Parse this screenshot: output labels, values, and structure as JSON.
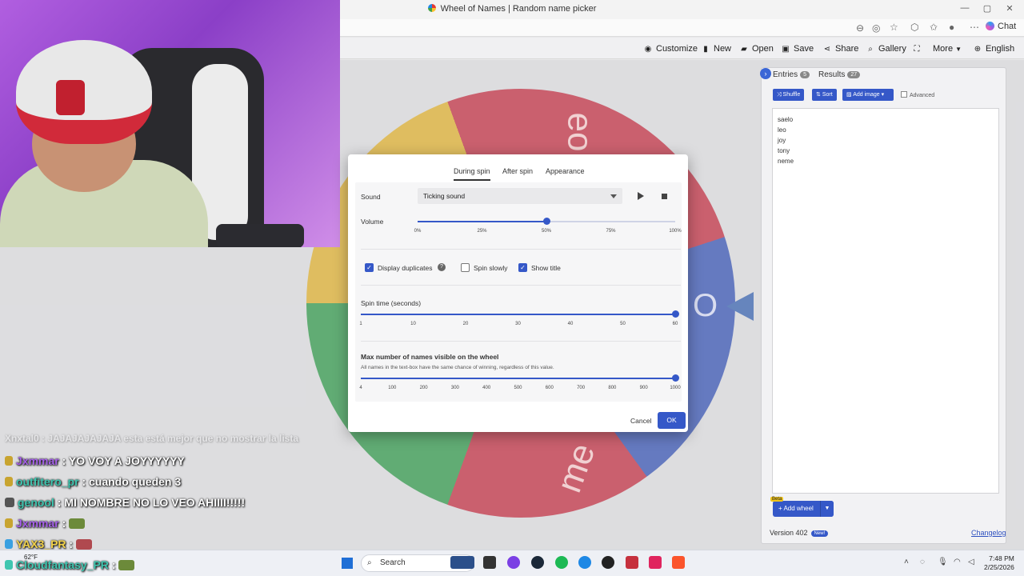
{
  "window": {
    "title": "Wheel of Names | Random name picker",
    "controls": [
      "—",
      "▢",
      "✕"
    ]
  },
  "browser": {
    "chat_label": "Chat"
  },
  "toolbar": {
    "customize": "Customize",
    "new": "New",
    "open": "Open",
    "save": "Save",
    "share": "Share",
    "gallery": "Gallery",
    "more": "More",
    "language": "English"
  },
  "wheel": {
    "labels": [
      "eo",
      "O",
      "me"
    ]
  },
  "panel": {
    "tabs": [
      {
        "label": "Entries",
        "count": "5"
      },
      {
        "label": "Results",
        "count": "27"
      }
    ],
    "shuffle": "Shuffle",
    "sort": "Sort",
    "add_image": "Add image",
    "advanced": "Advanced",
    "entries": [
      "saelo",
      "leo",
      "joy",
      "tony",
      "neme"
    ],
    "beta": "Beta",
    "add_wheel": "Add wheel",
    "version": "Version 402",
    "new_badge": "New!",
    "changelog": "Changelog"
  },
  "modal": {
    "tabs": [
      "During spin",
      "After spin",
      "Appearance"
    ],
    "active_tab": "During spin",
    "sound_label": "Sound",
    "sound_value": "Ticking sound",
    "volume_label": "Volume",
    "volume_value_percent": 50,
    "volume_ticks": [
      "0%",
      "25%",
      "50%",
      "75%",
      "100%"
    ],
    "display_duplicates": {
      "label": "Display duplicates",
      "checked": true
    },
    "spin_slowly": {
      "label": "Spin slowly",
      "checked": false
    },
    "show_title": {
      "label": "Show title",
      "checked": true
    },
    "spin_time_label": "Spin time (seconds)",
    "spin_time_value": 60,
    "spin_time_ticks": [
      "1",
      "10",
      "20",
      "30",
      "40",
      "50",
      "60"
    ],
    "max_names_label": "Max number of names visible on the wheel",
    "max_names_hint": "All names in the text-box have the same chance of winning, regardless of this value.",
    "max_names_value": 1000,
    "max_names_ticks": [
      "4",
      "100",
      "200",
      "300",
      "400",
      "500",
      "600",
      "700",
      "800",
      "900",
      "1000"
    ],
    "cancel": "Cancel",
    "ok": "OK"
  },
  "chat": [
    {
      "user": "Jxmmar",
      "text": ": YO VOY A JOYYYYYY",
      "color": "#a560e8"
    },
    {
      "user": "outfitero_pr",
      "text": ": cuando queden 3",
      "color": "#3fc6b0"
    },
    {
      "user": "genool",
      "text": ": MI NOMBRE NO LO VEO AHIIII!!!!!",
      "color": "#3fc6b0"
    },
    {
      "user": "Jxmmar",
      "text": ":",
      "color": "#a560e8"
    },
    {
      "user": "YAX3_PR",
      "text": ":",
      "color": "#f2d24a"
    },
    {
      "user": "Cloudfantasy_PR",
      "text": ":",
      "color": "#3fc6b0"
    }
  ],
  "chat_faded": "Xnxtal0 : JAJAJAJAJAJA esta está mejor que no mostrar la lista",
  "taskbar": {
    "search_placeholder": "Search",
    "weather_temp": "62°F",
    "time": "7:48 PM",
    "date": "2/25/2026"
  }
}
